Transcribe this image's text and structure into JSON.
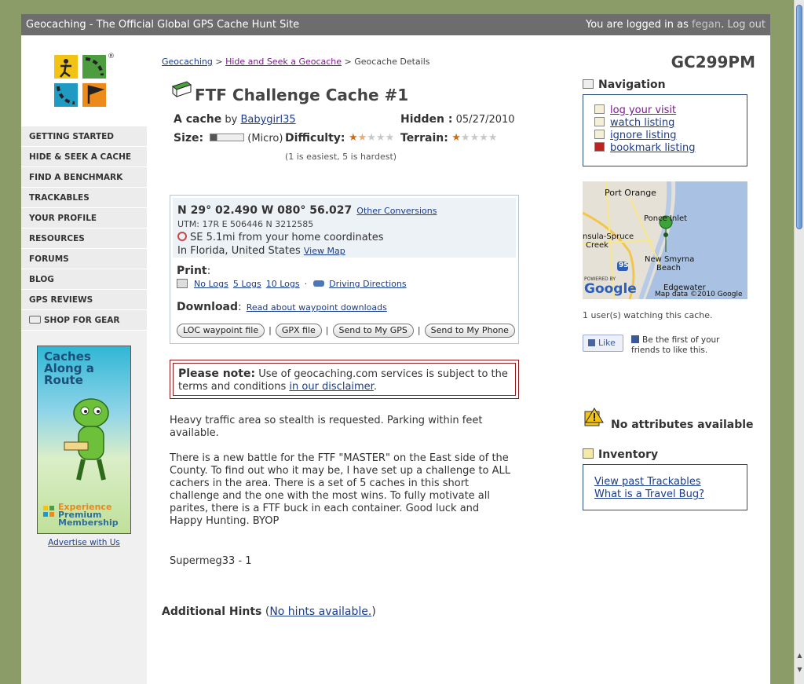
{
  "topbar": {
    "site_title": "Geocaching - The Official Global GPS Cache Hunt Site",
    "logged_in_prefix": "You are logged in as",
    "username": "fegan",
    "logout": "Log out"
  },
  "sidebar": {
    "items": [
      {
        "label": "GETTING STARTED"
      },
      {
        "label": "HIDE & SEEK A CACHE"
      },
      {
        "label": "FIND A BENCHMARK"
      },
      {
        "label": "TRACKABLES"
      },
      {
        "label": "YOUR PROFILE"
      },
      {
        "label": "RESOURCES"
      },
      {
        "label": "FORUMS"
      },
      {
        "label": "BLOG"
      },
      {
        "label": "GPS REVIEWS"
      },
      {
        "label": "SHOP FOR GEAR"
      }
    ],
    "ad": {
      "title": "Caches Along a Route",
      "subtitle_1": "Experience",
      "subtitle_2": "Premium Membership",
      "advertise_link": "Advertise with Us"
    }
  },
  "breadcrumb": {
    "root": "Geocaching",
    "section": "Hide and Seek a Geocache",
    "current": "Geocache Details",
    "sep": ">"
  },
  "cache": {
    "name": "FTF Challenge Cache #1",
    "code": "GC299PM",
    "type_label": "A cache",
    "by": "by",
    "owner": "Babygirl35",
    "hidden_label": "Hidden :",
    "hidden_date": "05/27/2010",
    "size_label": "Size:",
    "size_value": "(Micro)",
    "size_fraction": 0.2,
    "difficulty_label": "Difficulty:",
    "difficulty": 1.5,
    "terrain_label": "Terrain:",
    "terrain": 1,
    "rating_note": "(1 is easiest, 5 is hardest)"
  },
  "coords": {
    "value": "N 29° 02.490 W 080° 56.027",
    "other_conversions": "Other Conversions",
    "utm": "UTM: 17R E 506446 N 3212585",
    "distance": "SE 5.1mi from your home coordinates",
    "location": "In Florida, United States",
    "view_map": "View Map"
  },
  "print": {
    "title": "Print",
    "colon": ":",
    "no_logs": "No Logs",
    "logs_5": "5 Logs",
    "logs_10": "10 Logs",
    "dot": "·",
    "driving": "Driving Directions"
  },
  "download": {
    "title": "Download",
    "colon": ":",
    "read_about": "Read about waypoint downloads",
    "buttons": [
      "LOC waypoint file",
      "GPX file",
      "Send to My GPS",
      "Send to My Phone"
    ],
    "sep": "|"
  },
  "note": {
    "label": "Please note:",
    "text": "Use of geocaching.com services is subject to the terms and conditions",
    "link": "in our disclaimer",
    "end": "."
  },
  "description": {
    "short": "Heavy traffic area so stealth is requested. Parking within feet available.",
    "long": "There is a new battle for the FTF \"MASTER\" on the East side of the County. To find out who it may be, I have set up a challenge to ALL cachers in the area. There is a set of 5 caches in this short challenge and the one with the most wins. To fully motivate all parites, there is a FTF buck in each container. Good luck and Happy Hunting. BYOP",
    "signature": "Supermeg33 - 1"
  },
  "hints": {
    "title": "Additional Hints",
    "open": "(",
    "link": "No hints available.",
    "close": ")"
  },
  "navigation": {
    "title": "Navigation",
    "links": [
      "log your visit",
      "watch listing",
      "ignore listing",
      "bookmark listing"
    ]
  },
  "map": {
    "labels": [
      "Port Orange",
      "Ponce Inlet",
      "nsula-Spruce",
      "Creek",
      "New Smyrna",
      "Beach",
      "Edgewater",
      "95"
    ],
    "powered_by": "POWERED BY",
    "google": "Google",
    "attribution": "Map data ©2010 Google"
  },
  "social": {
    "watching": "1 user(s) watching this cache.",
    "like": "Like",
    "like_text": "Be the first of your friends to like this."
  },
  "attributes": {
    "none": "No attributes available"
  },
  "inventory": {
    "title": "Inventory",
    "past_trackables": "View past Trackables",
    "travel_bug": "What is a Travel Bug?"
  },
  "colors": {
    "background": "#8c9c68",
    "topbar": "#6d6d6d",
    "link": "#1a3c8c",
    "visited_link": "#7a1a8a",
    "star": "#d66a0f",
    "note_border": "#8c1a1a"
  }
}
